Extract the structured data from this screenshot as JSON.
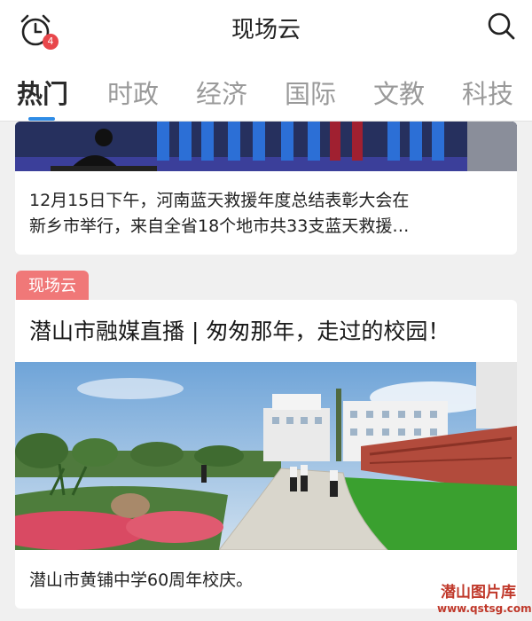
{
  "header": {
    "title": "现场云",
    "alarm_badge": "4",
    "alarm_icon": "alarm-clock-icon",
    "search_icon": "search-icon"
  },
  "tabs": [
    {
      "label": "热门",
      "active": true
    },
    {
      "label": "时政",
      "active": false
    },
    {
      "label": "经济",
      "active": false
    },
    {
      "label": "国际",
      "active": false
    },
    {
      "label": "文教",
      "active": false
    },
    {
      "label": "科技",
      "active": false
    }
  ],
  "card1": {
    "line1": "12月15日下午，河南蓝天救援年度总结表彰大会在",
    "line2": "新乡市举行，来自全省18个地市共33支蓝天救援…"
  },
  "card2": {
    "badge": "现场云",
    "title": "潜山市融媒直播 | 匆匆那年，走过的校园！",
    "caption": "潜山市黄铺中学60周年校庆。"
  },
  "watermark": {
    "name": "潜山图片库",
    "url": "www.qstsg.com"
  },
  "colors": {
    "accent": "#2f8ce6",
    "badge": "#f07878",
    "alarm_badge": "#e8474b",
    "watermark": "#c0392b"
  }
}
